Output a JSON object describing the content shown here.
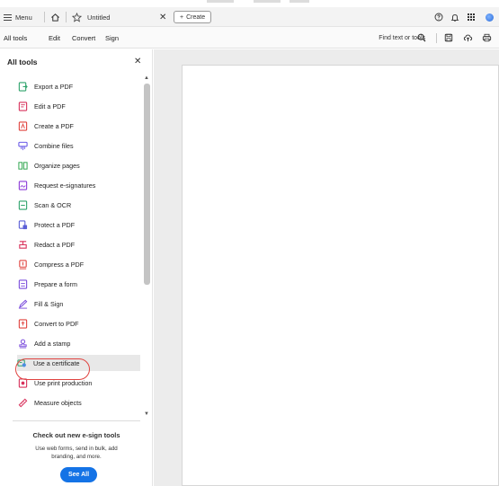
{
  "titlebar": {
    "menu_label": "Menu",
    "doc_title": "Untitled",
    "close_symbol": "✕",
    "create_label": "Create",
    "plus_symbol": "+",
    "icons": [
      "help-icon",
      "bell-icon",
      "apps-grid-icon",
      "profile-avatar"
    ]
  },
  "menubar": {
    "items": [
      "All tools",
      "Edit",
      "Convert",
      "Sign"
    ],
    "find_placeholder": "Find text or tools",
    "icons": [
      "search-icon",
      "save-icon",
      "cloud-upload-icon",
      "print-icon"
    ]
  },
  "panel": {
    "title": "All tools",
    "close_symbol": "✕",
    "tools": [
      {
        "label": "Export a PDF",
        "icon": "export-pdf-icon",
        "color": "#2ea36b"
      },
      {
        "label": "Edit a PDF",
        "icon": "edit-pdf-icon",
        "color": "#d8315b"
      },
      {
        "label": "Create a PDF",
        "icon": "create-pdf-icon",
        "color": "#e0433f"
      },
      {
        "label": "Combine files",
        "icon": "combine-files-icon",
        "color": "#6b5ce7"
      },
      {
        "label": "Organize pages",
        "icon": "organize-pages-icon",
        "color": "#34a853"
      },
      {
        "label": "Request e-signatures",
        "icon": "request-esignatures-icon",
        "color": "#8d3bd8"
      },
      {
        "label": "Scan & OCR",
        "icon": "scan-ocr-icon",
        "color": "#2ea36b"
      },
      {
        "label": "Protect a PDF",
        "icon": "protect-pdf-icon",
        "color": "#5b5fd6"
      },
      {
        "label": "Redact a PDF",
        "icon": "redact-pdf-icon",
        "color": "#d8315b"
      },
      {
        "label": "Compress a PDF",
        "icon": "compress-pdf-icon",
        "color": "#e0433f"
      },
      {
        "label": "Prepare a form",
        "icon": "prepare-form-icon",
        "color": "#7b4ddc"
      },
      {
        "label": "Fill & Sign",
        "icon": "fill-sign-icon",
        "color": "#7b4ddc"
      },
      {
        "label": "Convert to PDF",
        "icon": "convert-to-pdf-icon",
        "color": "#e0433f"
      },
      {
        "label": "Add a stamp",
        "icon": "add-stamp-icon",
        "color": "#7b4ddc"
      },
      {
        "label": "Use a certificate",
        "icon": "certificate-icon",
        "color": "#2ea36b"
      },
      {
        "label": "Use print production",
        "icon": "print-production-icon",
        "color": "#d8315b"
      },
      {
        "label": "Measure objects",
        "icon": "measure-objects-icon",
        "color": "#d8315b"
      }
    ],
    "selected_tool": "Use a certificate",
    "promo": {
      "title": "Check out new e-sign tools",
      "text": "Use web forms, send in bulk, add branding, and more.",
      "button_label": "See All"
    }
  },
  "colors": {
    "accent": "#1473e6",
    "highlight_ring": "#e0433f"
  }
}
